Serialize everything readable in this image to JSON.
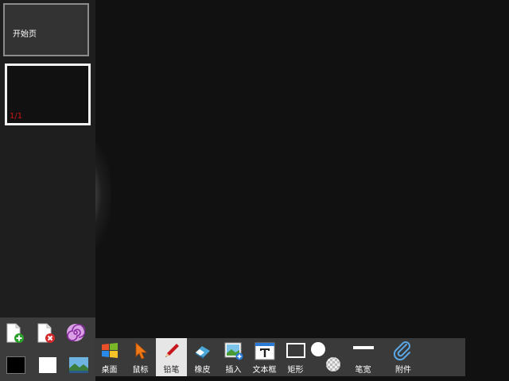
{
  "sidebar": {
    "start_page_label": "开始页",
    "page_indicator": "1/1"
  },
  "toolbar": {
    "active_tool": "铅笔",
    "items": [
      {
        "label": "桌面",
        "icon": "windows-logo-icon"
      },
      {
        "label": "鼠标",
        "icon": "mouse-cursor-icon"
      },
      {
        "label": "铅笔",
        "icon": "pencil-icon"
      },
      {
        "label": "橡皮",
        "icon": "eraser-icon"
      },
      {
        "label": "插入",
        "icon": "insert-image-icon"
      },
      {
        "label": "文本框",
        "icon": "textbox-icon"
      },
      {
        "label": "矩形",
        "icon": "rectangle-icon"
      },
      {
        "label": "",
        "icon": "color-fill-icon"
      },
      {
        "label": "笔宽",
        "icon": "pen-width-icon"
      },
      {
        "label": "附件",
        "icon": "paperclip-icon"
      }
    ]
  },
  "page_tools": [
    {
      "icon": "add-page-icon"
    },
    {
      "icon": "delete-page-icon"
    },
    {
      "icon": "spiral-icon"
    },
    {
      "icon": "black-background-icon"
    },
    {
      "icon": "white-background-icon"
    },
    {
      "icon": "image-background-icon"
    }
  ],
  "colors": {
    "background": "#111111",
    "panel": "#1e1e1e",
    "toolbar": "#3a3a3a",
    "active_tool": "#e6e6e6",
    "page_number": "#d21414"
  }
}
